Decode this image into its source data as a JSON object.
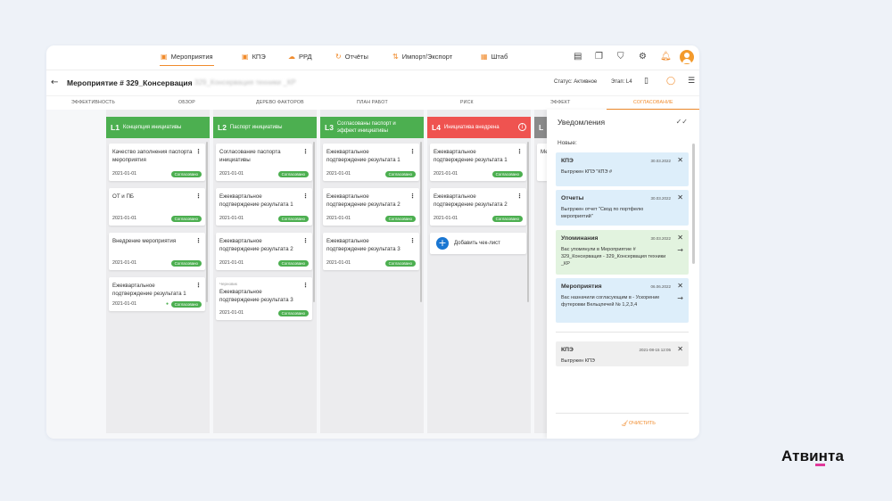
{
  "nav": {
    "items": [
      {
        "label": "Мероприятия",
        "icon": "window-icon"
      },
      {
        "label": "КПЭ",
        "icon": "kpi-icon"
      },
      {
        "label": "РРД",
        "icon": "cloud-icon"
      },
      {
        "label": "Отчёты",
        "icon": "refresh-icon"
      },
      {
        "label": "Импорт/Экспорт",
        "icon": "import-export-icon"
      },
      {
        "label": "Штаб",
        "icon": "calendar-icon"
      }
    ],
    "active": "Мероприятия"
  },
  "header": {
    "title": "Мероприятие # 329_Консервация",
    "title_blurred": "329_Консервация техники _КР",
    "status": "Статус: Активное",
    "stage": "Этап: L4"
  },
  "tabs": [
    "Эффективность",
    "Обзор",
    "Дерево факторов",
    "План работ",
    "Риск",
    "Эффект",
    "Согласование"
  ],
  "active_tab": "Согласование",
  "columns": [
    {
      "code": "L1",
      "title": "Концепция инициативы",
      "color": "#4caf50",
      "cards": [
        {
          "title": "Качество заполнения паспорта мероприятия",
          "date": "2021-01-01",
          "badge": "Согласовано"
        },
        {
          "title": "ОТ и ПБ",
          "date": "2021-01-01",
          "badge": "Согласовано"
        },
        {
          "title": "Внедрение мероприятия",
          "date": "2021-01-01",
          "badge": "Согласовано"
        },
        {
          "title": "Ежеквартальное подтверждение результата 1",
          "date": "2021-01-01",
          "badge": "Согласовано"
        }
      ]
    },
    {
      "code": "L2",
      "title": "Паспорт инициативы",
      "color": "#4caf50",
      "cards": [
        {
          "title": "Согласование паспорта инициативы",
          "date": "2021-01-01",
          "badge": "Согласовано"
        },
        {
          "title": "Ежеквартальное подтверждение результата 1",
          "date": "2021-01-01",
          "badge": "Согласовано"
        },
        {
          "title": "Ежеквартальное подтверждение результата 2",
          "date": "2021-01-01",
          "badge": "Согласовано"
        },
        {
          "title": "Ежеквартальное подтверждение результата 3",
          "date": "2021-01-01",
          "badge": "Согласовано",
          "draft": "Черновик"
        }
      ]
    },
    {
      "code": "L3",
      "title": "Согласованы паспорт и эффект инициативы",
      "color": "#4caf50",
      "cards": [
        {
          "title": "Ежеквартальное подтверждение результата 1",
          "date": "2021-01-01",
          "badge": "Согласовано"
        },
        {
          "title": "Ежеквартальное подтверждение результата 2",
          "date": "2021-01-01",
          "badge": "Согласовано"
        },
        {
          "title": "Ежеквартальное подтверждение результата 3",
          "date": "2021-01-01",
          "badge": "Согласовано"
        }
      ]
    },
    {
      "code": "L4",
      "title": "Инициатива внедрена",
      "color": "#ef5350",
      "cards": [
        {
          "title": "Ежеквартальное подтверждение результата 1",
          "date": "2021-01-01",
          "badge": "Согласовано"
        },
        {
          "title": "Ежеквартальное подтверждение результата 2",
          "date": "2021-01-01",
          "badge": "Согласовано"
        }
      ],
      "add_label": "Добавить чек-лист"
    },
    {
      "code": "L",
      "title": "Ме",
      "color": "#8a8a8a",
      "cards": []
    }
  ],
  "notifications": {
    "title": "Уведомления",
    "new_label": "Новые:",
    "items": [
      {
        "title": "КПЭ",
        "date": "30.03.2022",
        "text": "Выгружен КПЭ \"КПЭ #",
        "color": "blue"
      },
      {
        "title": "Отчеты",
        "date": "30.03.2022",
        "text": "Выгружен отчет \"Свод по портфелю мероприятий\"",
        "color": "blue"
      },
      {
        "title": "Упоминания",
        "date": "30.03.2022",
        "text": "Вас упомянули в  Мероприятие # 329_Консервация - 329_Консервация техники _КР",
        "color": "green"
      },
      {
        "title": "Мероприятия",
        "date": "06.06.2022",
        "text": "Вас назначили согласующим в - Ускорение футеровки Вельцпечей № 1,2,3,4",
        "color": "blue"
      }
    ],
    "old": [
      {
        "title": "КПЭ",
        "date": "2021-08-15  12:05",
        "text": "Выгружен КПЭ"
      }
    ],
    "clear_label": "Очистить"
  },
  "brand": {
    "name": "Атвинта"
  },
  "colors": {
    "accent": "#f08b2c",
    "green": "#4caf50",
    "red": "#ef5350",
    "blue_btn": "#1976d2"
  }
}
